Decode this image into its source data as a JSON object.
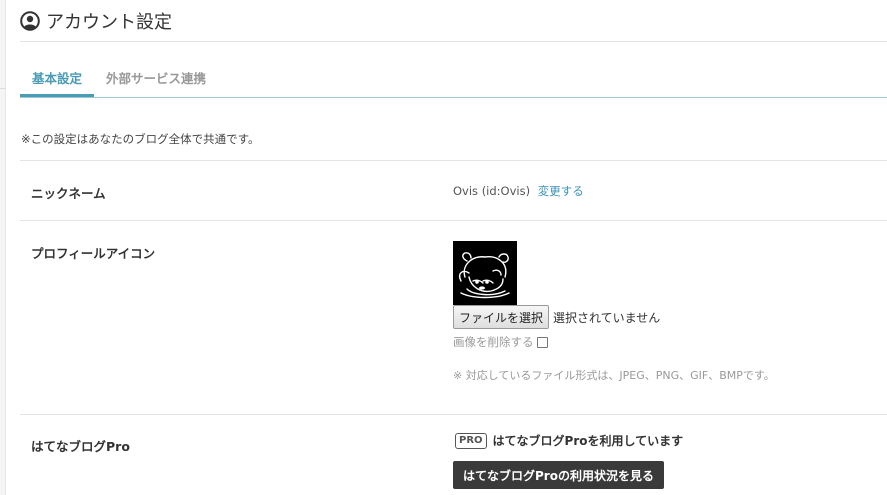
{
  "header": {
    "title": "アカウント設定",
    "icon": "user-circle-icon"
  },
  "tabs": [
    {
      "label": "基本設定",
      "active": true
    },
    {
      "label": "外部サービス連携",
      "active": false
    }
  ],
  "notice": "※この設定はあなたのブログ全体で共通です。",
  "nickname": {
    "label": "ニックネーム",
    "value": "Ovis (id:Ovis)",
    "change_link": "変更する"
  },
  "profile_icon": {
    "label": "プロフィールアイコン",
    "file_button": "ファイルを選択",
    "file_status": "選択されていません",
    "delete_label": "画像を削除する",
    "formats_note": "※ 対応しているファイル形式は、JPEG、PNG、GIF、BMPです。"
  },
  "pro": {
    "label": "はてなブログPro",
    "badge": "PRO",
    "status": "はてなブログProを利用しています",
    "button": "はてなブログProの利用状況を見る"
  },
  "colors": {
    "accent": "#4a9bb5",
    "link": "#3e93b5",
    "dark_button": "#3a3a3a"
  }
}
